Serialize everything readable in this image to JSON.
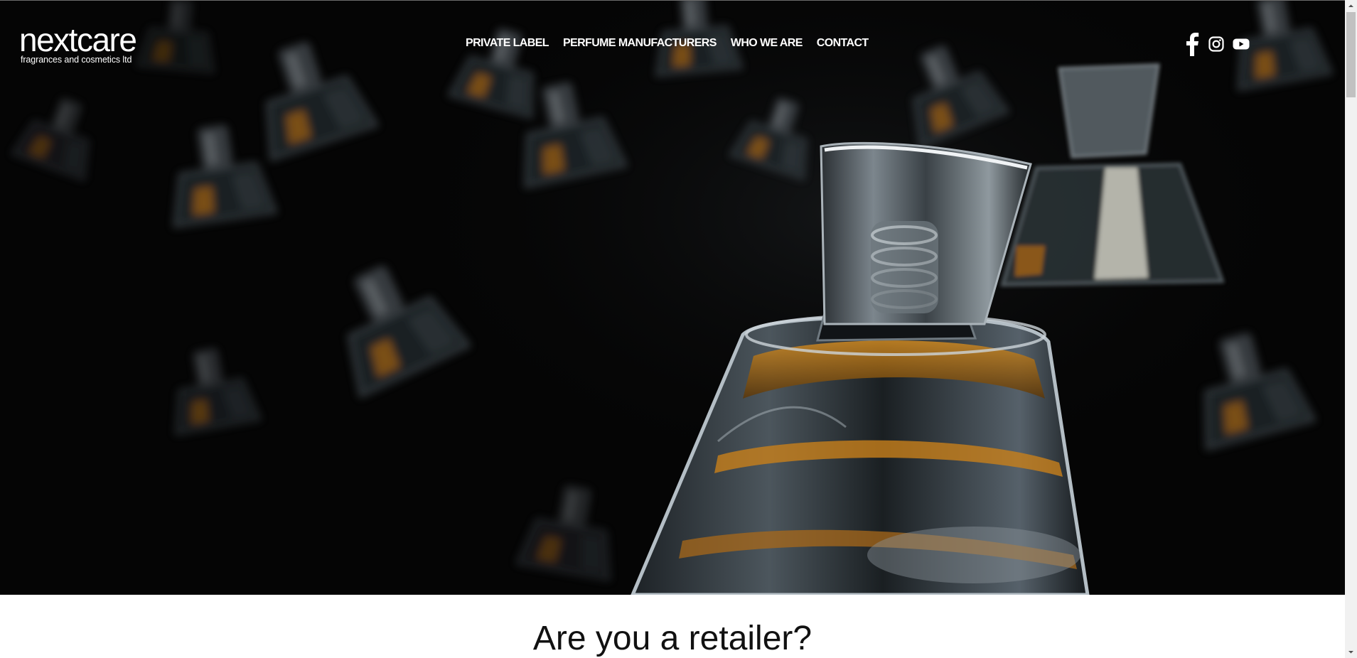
{
  "header": {
    "logo": {
      "wordmark": "nextcare",
      "tagline": "fragrances and cosmetics ltd"
    },
    "nav": [
      {
        "label": "PRIVATE LABEL"
      },
      {
        "label": "PERFUME MANUFACTURERS"
      },
      {
        "label": "WHO WE ARE"
      },
      {
        "label": "CONTACT"
      }
    ],
    "social": [
      {
        "icon": "facebook-icon"
      },
      {
        "icon": "instagram-icon"
      },
      {
        "icon": "youtube-icon"
      }
    ]
  },
  "hero": {
    "image_subject": "perfume-bottles",
    "colors": {
      "background": "#050505",
      "accent_amber": "#c8801a",
      "glass": "#9aa3aa"
    }
  },
  "section": {
    "heading": "Are you a retailer?"
  }
}
